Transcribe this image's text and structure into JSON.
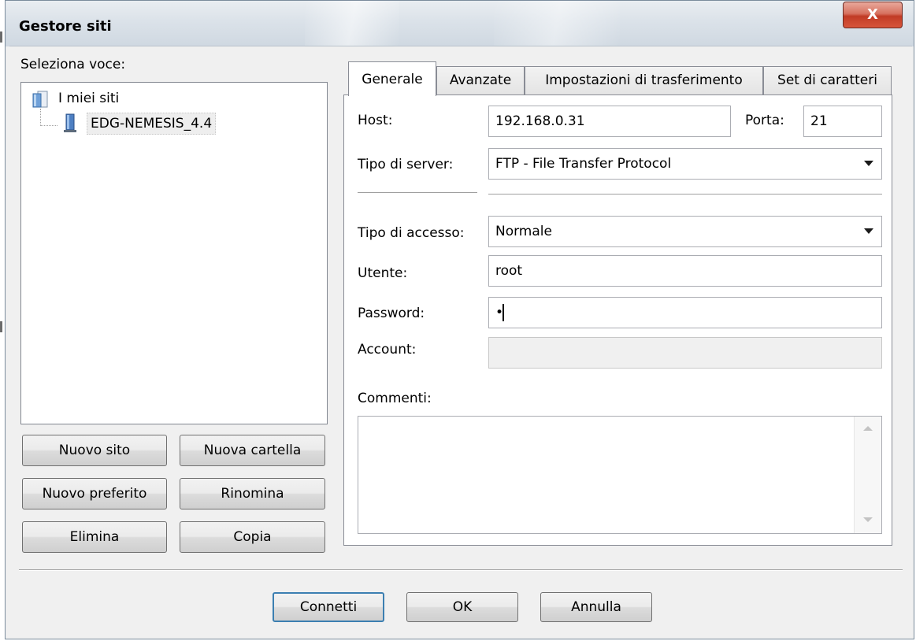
{
  "window": {
    "title": "Gestore siti",
    "close_glyph": "X"
  },
  "left": {
    "select_label": "Seleziona voce:",
    "tree": {
      "root_label": "I miei siti",
      "root_icon": "folder-icon",
      "site_label": "EDG-NEMESIS_4.4",
      "site_icon": "server-icon"
    },
    "buttons": {
      "new_site": "Nuovo sito",
      "new_folder": "Nuova cartella",
      "new_bookmark": "Nuovo preferito",
      "rename": "Rinomina",
      "delete": "Elimina",
      "copy": "Copia"
    }
  },
  "tabs": {
    "general": "Generale",
    "advanced": "Avanzate",
    "transfer": "Impostazioni di trasferimento",
    "charset": "Set di caratteri",
    "active": "general"
  },
  "general": {
    "host_label": "Host:",
    "host_value": "192.168.0.31",
    "port_label": "Porta:",
    "port_value": "21",
    "server_type_label": "Tipo di server:",
    "server_type_value": "FTP - File Transfer Protocol",
    "logon_type_label": "Tipo di accesso:",
    "logon_type_value": "Normale",
    "user_label": "Utente:",
    "user_value": "root",
    "password_label": "Password:",
    "password_value": "•",
    "account_label": "Account:",
    "account_value": "",
    "comments_label": "Commenti:",
    "comments_value": ""
  },
  "footer": {
    "connect": "Connetti",
    "ok": "OK",
    "cancel": "Annulla"
  },
  "colors": {
    "close_button": "#c13b25",
    "default_button_border": "#3c7fb1",
    "dialog_background": "#f0f0f0"
  }
}
